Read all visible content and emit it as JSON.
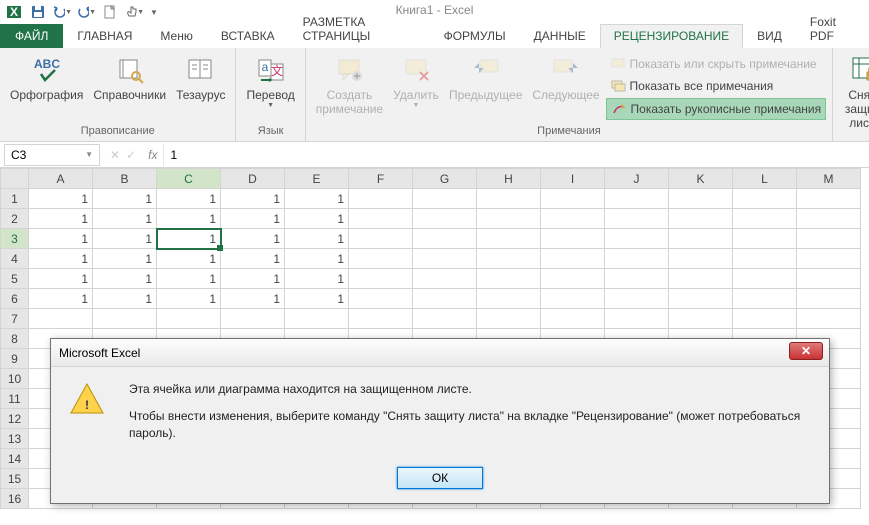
{
  "app_title": "Книга1 - Excel",
  "qat": {
    "excel": "",
    "save": "",
    "undo": "",
    "redo": "",
    "new": "",
    "touch": ""
  },
  "tabs": {
    "file": "ФАЙЛ",
    "home": "ГЛАВНАЯ",
    "menu": "Меню",
    "insert": "ВСТАВКА",
    "layout": "РАЗМЕТКА СТРАНИЦЫ",
    "formulas": "ФОРМУЛЫ",
    "data": "ДАННЫЕ",
    "review": "РЕЦЕНЗИРОВАНИЕ",
    "view": "ВИД",
    "foxit": "Foxit PDF"
  },
  "ribbon": {
    "proofing": {
      "label": "Правописание",
      "spelling": "Орфография",
      "research": "Справочники",
      "thesaurus": "Тезаурус"
    },
    "language": {
      "label": "Язык",
      "translate": "Перевод"
    },
    "comments": {
      "label": "Примечания",
      "new": "Создать\nпримечание",
      "delete": "Удалить",
      "prev": "Предыдущее",
      "next": "Следующее",
      "show_hide": "Показать или скрыть примечание",
      "show_all": "Показать все примечания",
      "show_ink": "Показать рукописные примечания"
    },
    "changes": {
      "unprotect": "Снять\nзащиту листа"
    }
  },
  "formula_bar": {
    "name_box": "C3",
    "fx": "fx",
    "value": "1"
  },
  "columns": [
    "A",
    "B",
    "C",
    "D",
    "E",
    "F",
    "G",
    "H",
    "I",
    "J",
    "K",
    "L",
    "M"
  ],
  "rows": [
    "1",
    "2",
    "3",
    "4",
    "5",
    "6",
    "7",
    "8",
    "9",
    "10",
    "11",
    "12",
    "13",
    "14",
    "15",
    "16"
  ],
  "cells": {
    "1": [
      "1",
      "1",
      "1",
      "1",
      "1",
      "",
      "",
      "",
      "",
      "",
      "",
      "",
      ""
    ],
    "2": [
      "1",
      "1",
      "1",
      "1",
      "1",
      "",
      "",
      "",
      "",
      "",
      "",
      "",
      ""
    ],
    "3": [
      "1",
      "1",
      "1",
      "1",
      "1",
      "",
      "",
      "",
      "",
      "",
      "",
      "",
      ""
    ],
    "4": [
      "1",
      "1",
      "1",
      "1",
      "1",
      "",
      "",
      "",
      "",
      "",
      "",
      "",
      ""
    ],
    "5": [
      "1",
      "1",
      "1",
      "1",
      "1",
      "",
      "",
      "",
      "",
      "",
      "",
      "",
      ""
    ],
    "6": [
      "1",
      "1",
      "1",
      "1",
      "1",
      "",
      "",
      "",
      "",
      "",
      "",
      "",
      ""
    ]
  },
  "active": {
    "row": 3,
    "col": 2
  },
  "dialog": {
    "title": "Microsoft Excel",
    "line1": "Эта ячейка или диаграмма находится на защищенном листе.",
    "line2": "Чтобы внести изменения, выберите команду \"Снять защиту листа\" на вкладке \"Рецензирование\" (может потребоваться пароль).",
    "ok": "ОК"
  }
}
